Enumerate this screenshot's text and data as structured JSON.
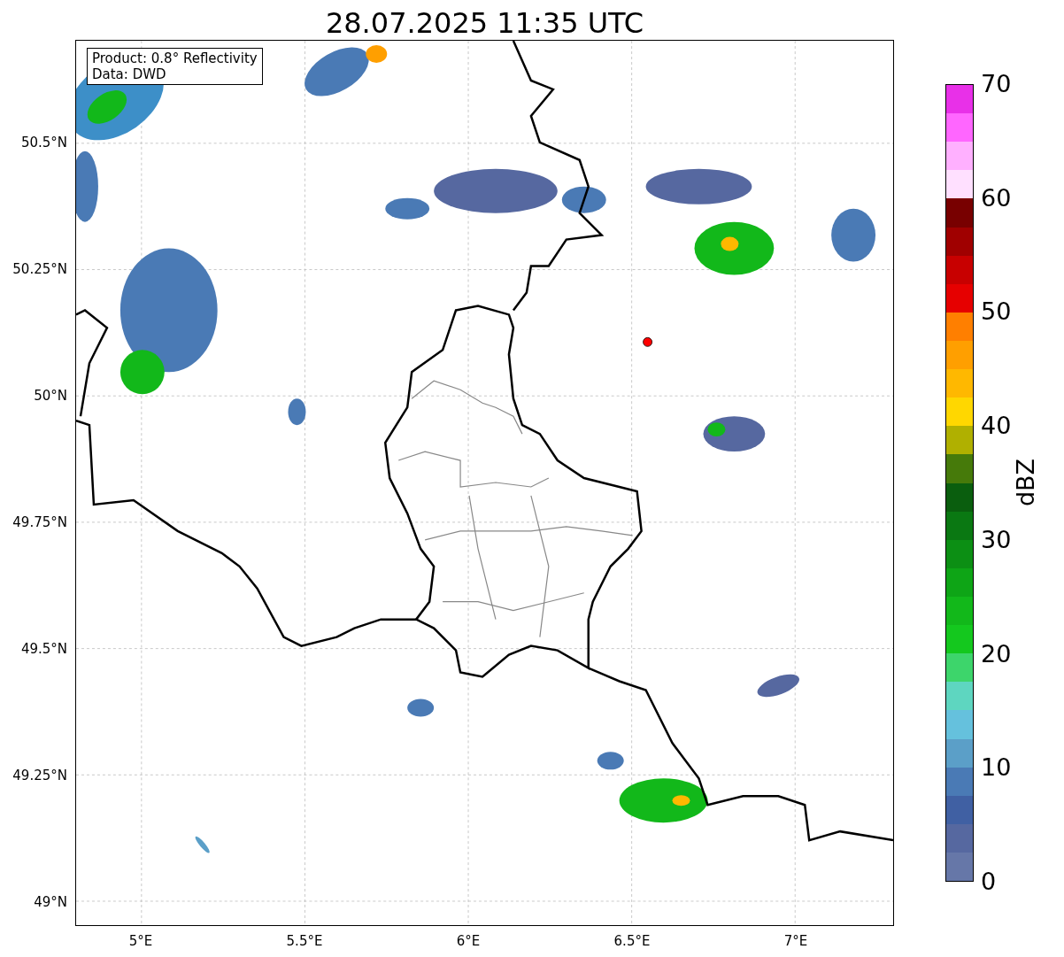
{
  "title": "28.07.2025 11:35 UTC",
  "map": {
    "legend": [
      "Product: 0.8° Reflectivity",
      "Data: DWD"
    ],
    "y_ticks": [
      "50.5°N",
      "50.25°N",
      "50°N",
      "49.75°N",
      "49.5°N",
      "49.25°N",
      "49°N"
    ],
    "x_ticks": [
      "5°E",
      "5.5°E",
      "6°E",
      "6.5°E",
      "7°E"
    ]
  },
  "colorbar": {
    "label": "dBZ",
    "ticks": [
      "70",
      "60",
      "50",
      "40",
      "30",
      "20",
      "10",
      "0"
    ],
    "bands": [
      {
        "color": "#e830e8"
      },
      {
        "color": "#ff66ff"
      },
      {
        "color": "#ffb0ff"
      },
      {
        "color": "#ffe0ff"
      },
      {
        "color": "#780000"
      },
      {
        "color": "#a00000"
      },
      {
        "color": "#c80000"
      },
      {
        "color": "#e60000"
      },
      {
        "color": "#ff7f00"
      },
      {
        "color": "#ff9f00"
      },
      {
        "color": "#ffb800"
      },
      {
        "color": "#ffd700"
      },
      {
        "color": "#b0b000"
      },
      {
        "color": "#467a0a"
      },
      {
        "color": "#0a5e0e"
      },
      {
        "color": "#0a7812"
      },
      {
        "color": "#0c8f14"
      },
      {
        "color": "#0ea516"
      },
      {
        "color": "#12b81a"
      },
      {
        "color": "#14c81e"
      },
      {
        "color": "#3dd56b"
      },
      {
        "color": "#5ed6c0"
      },
      {
        "color": "#65c1dd"
      },
      {
        "color": "#5b9fc8"
      },
      {
        "color": "#4a7ab5"
      },
      {
        "color": "#4060a3"
      },
      {
        "color": "#5668a0"
      },
      {
        "color": "#6677a8"
      }
    ]
  }
}
